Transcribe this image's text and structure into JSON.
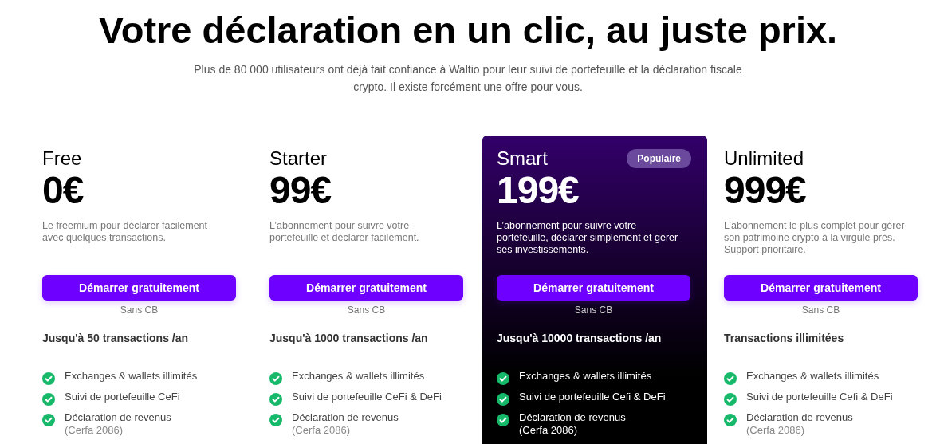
{
  "heading": "Votre déclaration en un clic, au juste prix.",
  "intro": "Plus de 80 000 utilisateurs ont déjà fait confiance à Waltio pour leur suivi de portefeuille et la déclaration fiscale crypto. Il existe forcément une offre pour vous.",
  "plans": [
    {
      "name": "Free",
      "featured": false,
      "price": "0€",
      "description": "Le freemium pour déclarer facilement avec quelques transactions.",
      "button": "Démarrer gratuitement",
      "button_note": "Sans CB",
      "limit": "Jusqu'à 50 transactions /an",
      "features": [
        {
          "text": "Exchanges & wallets illimités"
        },
        {
          "text": "Suivi de portefeuille CeFi"
        },
        {
          "text": "Déclaration de revenus",
          "note": "(Cerfa 2086)"
        }
      ]
    },
    {
      "name": "Starter",
      "featured": false,
      "price": "99€",
      "description": "L’abonnement pour suivre votre portefeuille et déclarer facilement.",
      "button": "Démarrer gratuitement",
      "button_note": "Sans CB",
      "limit": "Jusqu'à 1000 transactions /an",
      "features": [
        {
          "text": "Exchanges & wallets illimités"
        },
        {
          "text": "Suivi de portefeuille CeFi & DeFi"
        },
        {
          "text": "Déclaration de revenus",
          "note": "(Cerfa 2086)"
        }
      ]
    },
    {
      "name": "Smart",
      "featured": true,
      "badge": "Populaire",
      "price": "199€",
      "description": "L’abonnement pour suivre votre portefeuille, déclarer simplement et gérer ses investissements.",
      "button": "Démarrer gratuitement",
      "button_note": "Sans CB",
      "limit": "Jusqu'à 10000 transactions /an",
      "features": [
        {
          "text": "Exchanges & wallets illimités"
        },
        {
          "text": "Suivi de portefeuille Cefi & DeFi"
        },
        {
          "text": "Déclaration de revenus",
          "note": "(Cerfa 2086)"
        }
      ]
    },
    {
      "name": "Unlimited",
      "featured": false,
      "price": "999€",
      "description": "L’abonnement le plus complet pour gérer son patrimoine crypto à la virgule près. Support prioritaire.",
      "button": "Démarrer gratuitement",
      "button_note": "Sans CB",
      "limit": "Transactions illimitées",
      "features": [
        {
          "text": "Exchanges & wallets illimités"
        },
        {
          "text": "Suivi de portefeuille Cefi & DeFi"
        },
        {
          "text": "Déclaration de revenus",
          "note": "(Cerfa 2086)"
        }
      ]
    }
  ]
}
